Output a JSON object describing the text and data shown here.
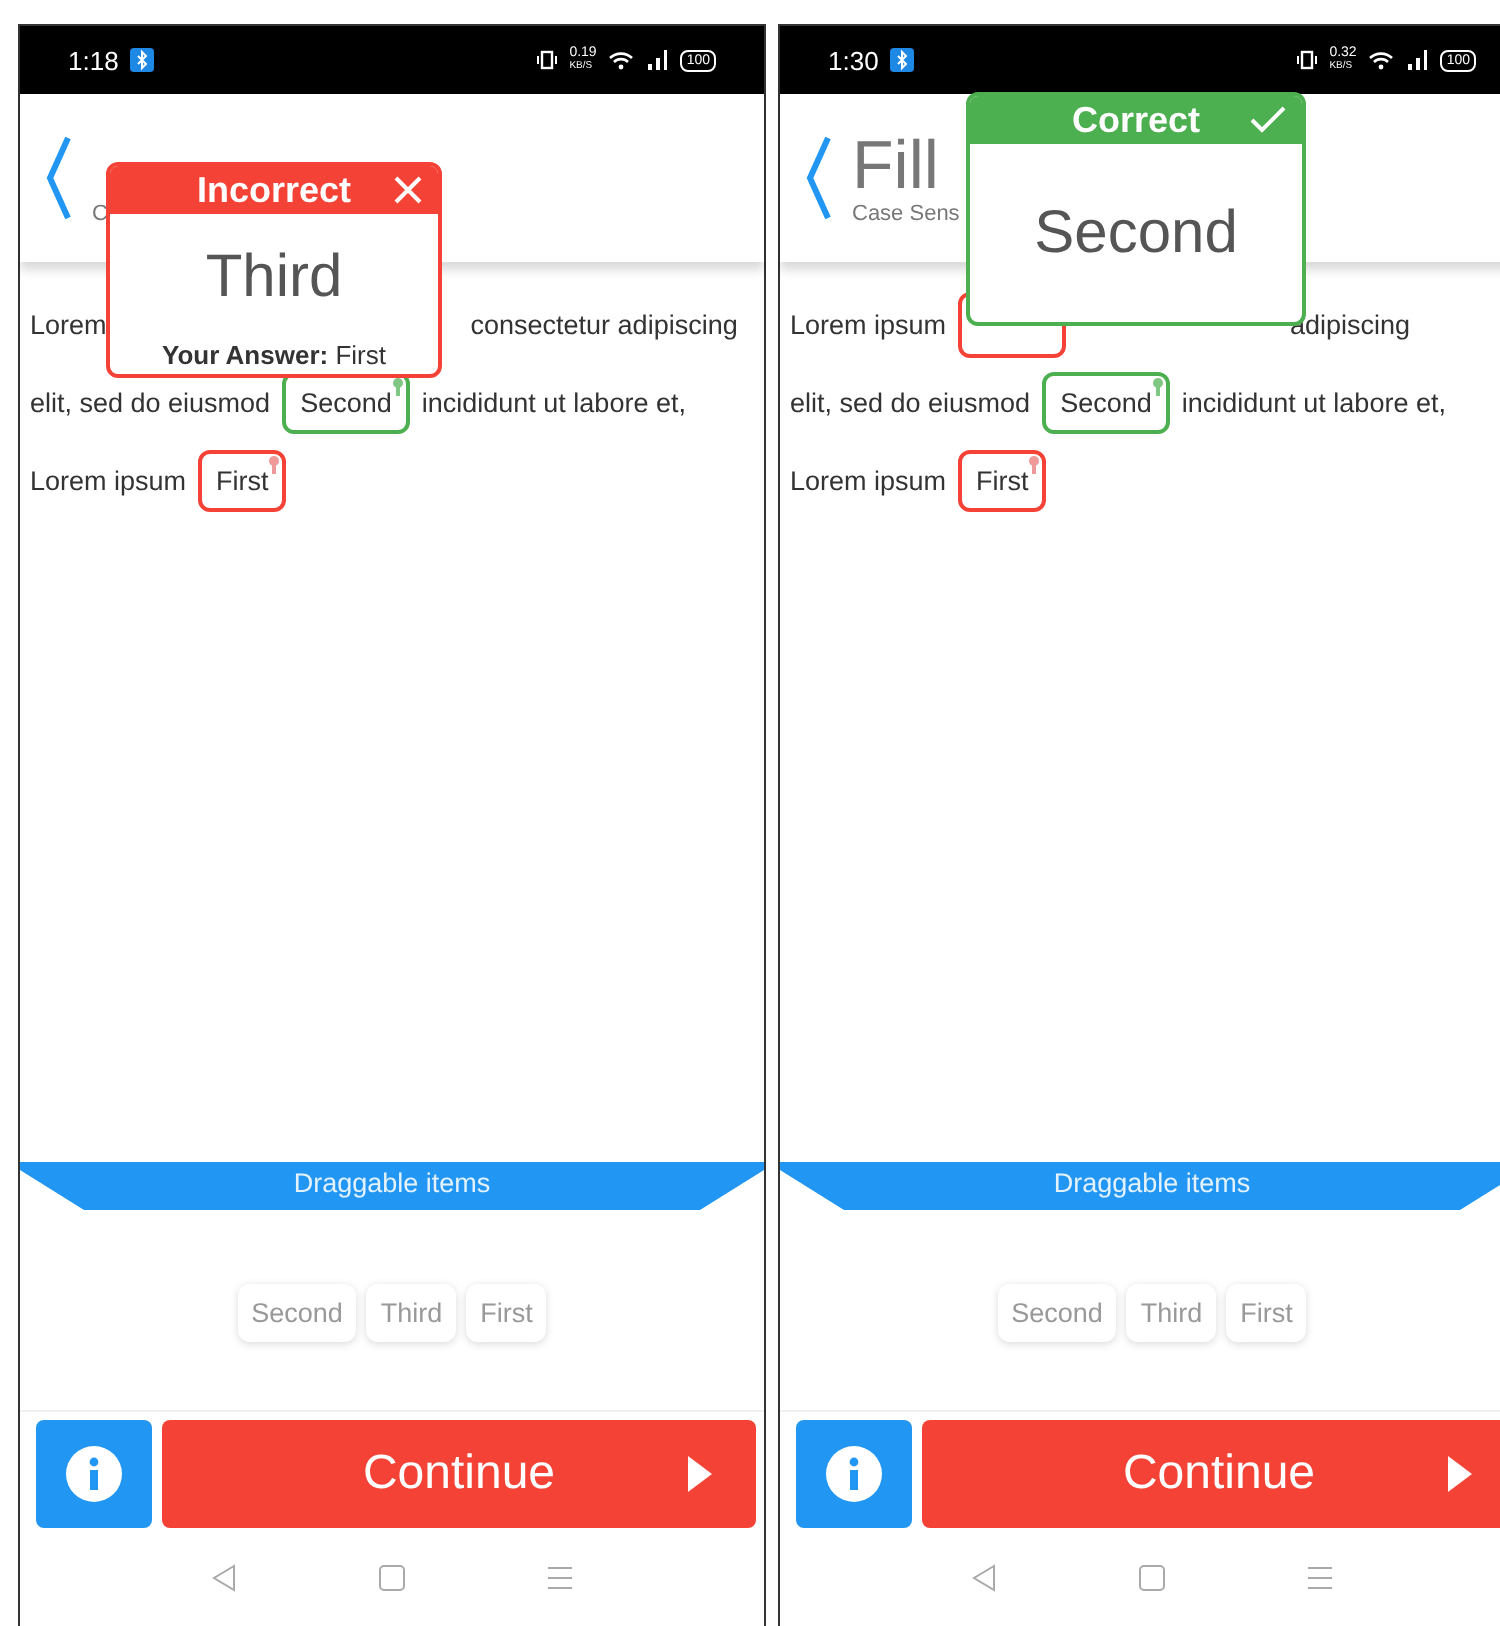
{
  "screens": [
    {
      "status_bar": {
        "time": "1:18",
        "speed": "0.19",
        "speed_unit": "KB/S",
        "battery": "100"
      },
      "header": {
        "subtitle": "C"
      },
      "lines": [
        {
          "parts": [
            {
              "kind": "text",
              "text": "Lorem"
            },
            {
              "kind": "gap"
            },
            {
              "kind": "text",
              "text": "consectetur adipiscing"
            }
          ]
        },
        {
          "parts": [
            {
              "kind": "text",
              "text": "elit, sed do eiusmod"
            },
            {
              "kind": "slot",
              "text": "Second",
              "correct": true
            },
            {
              "kind": "text",
              "text": "incididunt ut labore et,"
            }
          ]
        },
        {
          "parts": [
            {
              "kind": "text",
              "text": "Lorem ipsum"
            },
            {
              "kind": "slot",
              "text": "First",
              "correct": false
            }
          ]
        }
      ],
      "popup": {
        "kind": "incorrect",
        "title": "Incorrect",
        "answer": "Third",
        "footer": "**Your Answer:** First"
      },
      "banner": "Draggable items",
      "chips": [
        "Second",
        "Third",
        "First"
      ],
      "continue_label": "Continue"
    },
    {
      "status_bar": {
        "time": "1:30",
        "speed": "0.32",
        "speed_unit": "KB/S",
        "battery": "100"
      },
      "header": {
        "title": "Fill",
        "subtitle": "Case Sens"
      },
      "lines": [
        {
          "parts": [
            {
              "kind": "text",
              "text": "Lorem ipsum"
            },
            {
              "kind": "slot",
              "correct": false
            },
            {
              "kind": "gap"
            },
            {
              "kind": "text",
              "text": "adipiscing"
            }
          ]
        },
        {
          "parts": [
            {
              "kind": "text",
              "text": "elit, sed do eiusmod"
            },
            {
              "kind": "slot",
              "text": "Second",
              "correct": true
            },
            {
              "kind": "text",
              "text": "incididunt ut labore et,"
            }
          ]
        },
        {
          "parts": [
            {
              "kind": "text",
              "text": "Lorem ipsum"
            },
            {
              "kind": "slot",
              "text": "First",
              "correct": false
            }
          ]
        }
      ],
      "popup": {
        "kind": "correct",
        "title": "Correct",
        "answer": "Second"
      },
      "banner": "Draggable items",
      "chips": [
        "Second",
        "Third",
        "First"
      ],
      "continue_label": "Continue"
    }
  ]
}
